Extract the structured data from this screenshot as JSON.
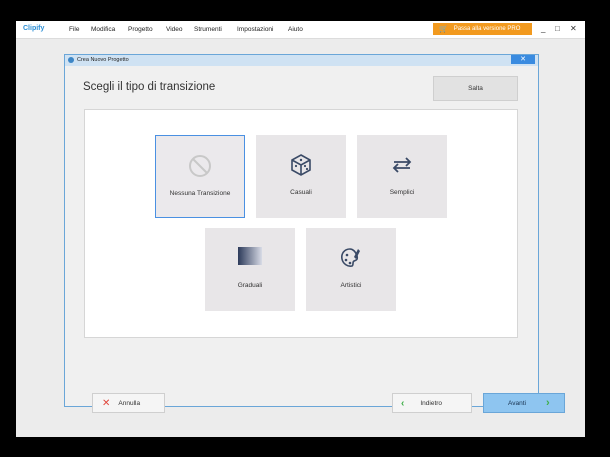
{
  "app": {
    "brand": "Clipify",
    "menu": [
      "File",
      "Modifica",
      "Progetto",
      "Video",
      "Strumenti",
      "Impostazioni",
      "Aiuto"
    ],
    "pro_button": "Passa alla versione PRO",
    "window_controls": {
      "minimize": "_",
      "maximize": "□",
      "close": "✕"
    }
  },
  "dialog": {
    "title": "Crea Nuovo Progetto",
    "close_label": "✕",
    "heading": "Scegli il tipo di transizione",
    "skip_label": "Salta",
    "options": [
      {
        "label": "Nessuna Transizione",
        "icon": "no-transition-icon",
        "selected": true
      },
      {
        "label": "Casuali",
        "icon": "dice-icon",
        "selected": false
      },
      {
        "label": "Semplici",
        "icon": "swap-arrows-icon",
        "selected": false
      },
      {
        "label": "Graduali",
        "icon": "gradient-icon",
        "selected": false
      },
      {
        "label": "Artistici",
        "icon": "palette-icon",
        "selected": false
      }
    ],
    "cancel_label": "Annulla",
    "back_label": "Indietro",
    "next_label": "Avanti"
  },
  "colors": {
    "accent": "#2b8fd6",
    "pro": "#f29a1f",
    "next_button": "#8ec5f0"
  }
}
